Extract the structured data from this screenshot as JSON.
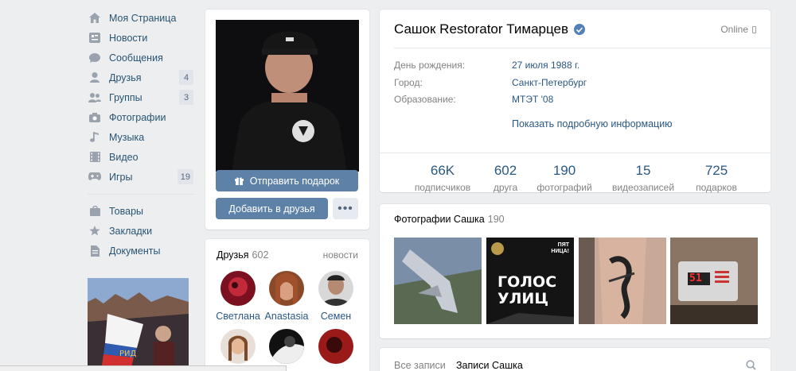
{
  "sidebar": {
    "items": [
      {
        "label": "Моя Страница",
        "icon": "home-icon"
      },
      {
        "label": "Новости",
        "icon": "news-icon"
      },
      {
        "label": "Сообщения",
        "icon": "messages-icon"
      },
      {
        "label": "Друзья",
        "icon": "user-icon",
        "count": "4"
      },
      {
        "label": "Группы",
        "icon": "groups-icon",
        "count": "3"
      },
      {
        "label": "Фотографии",
        "icon": "camera-icon"
      },
      {
        "label": "Музыка",
        "icon": "music-icon"
      },
      {
        "label": "Видео",
        "icon": "video-icon"
      },
      {
        "label": "Игры",
        "icon": "gamepad-icon",
        "count": "19"
      }
    ],
    "items2": [
      {
        "label": "Товары",
        "icon": "shop-icon"
      },
      {
        "label": "Закладки",
        "icon": "star-icon"
      },
      {
        "label": "Документы",
        "icon": "document-icon"
      }
    ]
  },
  "avatar": {
    "gift_label": "Отправить подарок",
    "add_label": "Добавить в друзья",
    "more_label": "•••"
  },
  "friends": {
    "title": "Друзья",
    "count": "602",
    "news_link": "новости",
    "list": [
      {
        "name": "Светлана"
      },
      {
        "name": "Anastasia"
      },
      {
        "name": "Семен"
      }
    ]
  },
  "profile": {
    "name": "Сашок Restorator Тимарцев",
    "online": "Online",
    "info": [
      {
        "key": "День рождения:",
        "value": "27 июля 1988 г."
      },
      {
        "key": "Город:",
        "value": "Санкт-Петербург"
      },
      {
        "key": "Образование:",
        "value": "МТЭТ '08"
      }
    ],
    "more_info": "Показать подробную информацию",
    "stats": [
      {
        "num": "66K",
        "label": "подписчиков"
      },
      {
        "num": "602",
        "label": "друга"
      },
      {
        "num": "190",
        "label": "фотографий"
      },
      {
        "num": "15",
        "label": "видеозаписей"
      },
      {
        "num": "725",
        "label": "подарков"
      }
    ]
  },
  "photos": {
    "title": "Фотографии Сашка",
    "count": "190",
    "thumb2_text": "ГОЛОС УЛИЦ",
    "thumb2_corner": "ПЯТ НИЦА!",
    "thumb4_text": "51"
  },
  "posts": {
    "tab_all": "Все записи",
    "tab_own": "Записи Сашка"
  },
  "colors": {
    "accent": "#5e81a8",
    "link": "#2a5885",
    "bg": "#edeef0"
  }
}
